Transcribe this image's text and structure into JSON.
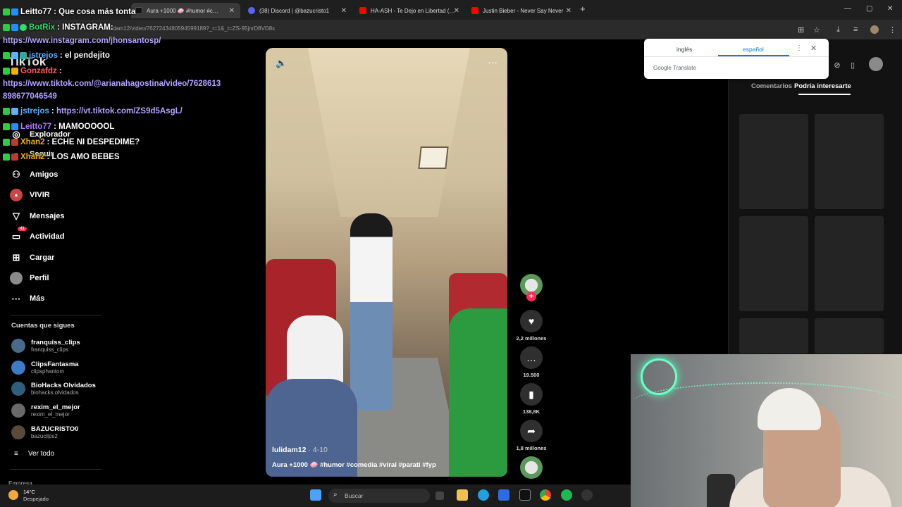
{
  "browser": {
    "tabs": [
      {
        "label": "Aura +1000 🧼 #humor #c…",
        "active": true
      },
      {
        "label": "(38) Discord | @bazucristo1"
      },
      {
        "label": "HA-ASH - Te Dejo en Libertad (…"
      },
      {
        "label": "Justin Bieber - Never Say Never"
      }
    ],
    "url": "lulidam12/video/7627243480594599189?_r=1&_t=ZS-95jnrD8VD8x",
    "new_tab": "+",
    "close": "✕",
    "min": "—",
    "max": "▢"
  },
  "chat": {
    "top_user": "Leitto77",
    "top_msg": "Que cosa más tonta",
    "lines": [
      {
        "user": "BotRix",
        "user_color": "#2ee06a",
        "msg": "INSTAGRAM:"
      },
      {
        "link": "https://www.instagram.com/jhonsantosp/"
      },
      {
        "user": "jstrejos",
        "user_color": "#5fb0ff",
        "msg": "el pendejito"
      },
      {
        "user": "Gonzafdz",
        "user_color": "#ff5e5e",
        "msg": ""
      },
      {
        "link": "https://www.tiktok.com/@arianahagostina/video/7628613"
      },
      {
        "link": "898677046549"
      },
      {
        "user": "jstrejos",
        "user_color": "#5fb0ff",
        "msg": "",
        "link": "https://vt.tiktok.com/ZS9d5AsgL/"
      },
      {
        "user": "Leitto77",
        "user_color": "#b07cff",
        "msg": "MAMOOOOOL"
      },
      {
        "user": "Xhan2",
        "user_color": "#f0b000",
        "msg": "ECHE NI DESPEDIME?"
      },
      {
        "user": "Xhan2",
        "user_color": "#f0b000",
        "msg": "LOS AMO BEBES"
      }
    ]
  },
  "tiktok": {
    "logo": "TikTok",
    "nav": [
      {
        "label": "Explorador",
        "icon": "compass-icon"
      },
      {
        "label": "Seguir",
        "icon": "following-icon"
      },
      {
        "label": "Amigos",
        "icon": "friends-icon"
      },
      {
        "label": "VIVIR",
        "icon": "live-icon"
      },
      {
        "label": "Mensajes",
        "icon": "send-icon"
      },
      {
        "label": "Actividad",
        "icon": "inbox-icon",
        "badge": "41"
      },
      {
        "label": "Cargar",
        "icon": "upload-icon"
      },
      {
        "label": "Perfil",
        "icon": "profile-avatar-icon"
      },
      {
        "label": "Más",
        "icon": "more-icon"
      }
    ],
    "following_title": "Cuentas que sigues",
    "accounts": [
      {
        "name": "franquiss_clips",
        "handle": "franquiss_clips",
        "color": "#4a6a8a"
      },
      {
        "name": "ClipsFantasma",
        "handle": "clipsphantom",
        "color": "#3d7cc4"
      },
      {
        "name": "BioHacks Olvidados",
        "handle": "biohacks.olvidados",
        "color": "#2f5f7a"
      },
      {
        "name": "rexim_el_mejor",
        "handle": "rexim_el_mejor",
        "color": "#6a6a6a"
      },
      {
        "name": "BAZUCRISTO0",
        "handle": "bazuclips2",
        "color": "#5a4a3a"
      }
    ],
    "see_all": "Ver todo",
    "footer": "Empresa"
  },
  "video": {
    "user": "lulidam12",
    "date": "· 4-10",
    "caption": "Aura +1000 🧼 #humor #comedia #viral #parati #fyp",
    "likes": "2,2 millones",
    "comments": "19.500",
    "saves": "138,8K",
    "shares": "1,8 millones"
  },
  "right_panel": {
    "tab_comments": "Comentarios",
    "tab_suggested": "Podría interesarte"
  },
  "translate": {
    "source": "inglés",
    "target": "español",
    "brand": "Google Translate"
  },
  "taskbar": {
    "temp": "14°C",
    "weather": "Despejado",
    "search_placeholder": "Buscar"
  }
}
